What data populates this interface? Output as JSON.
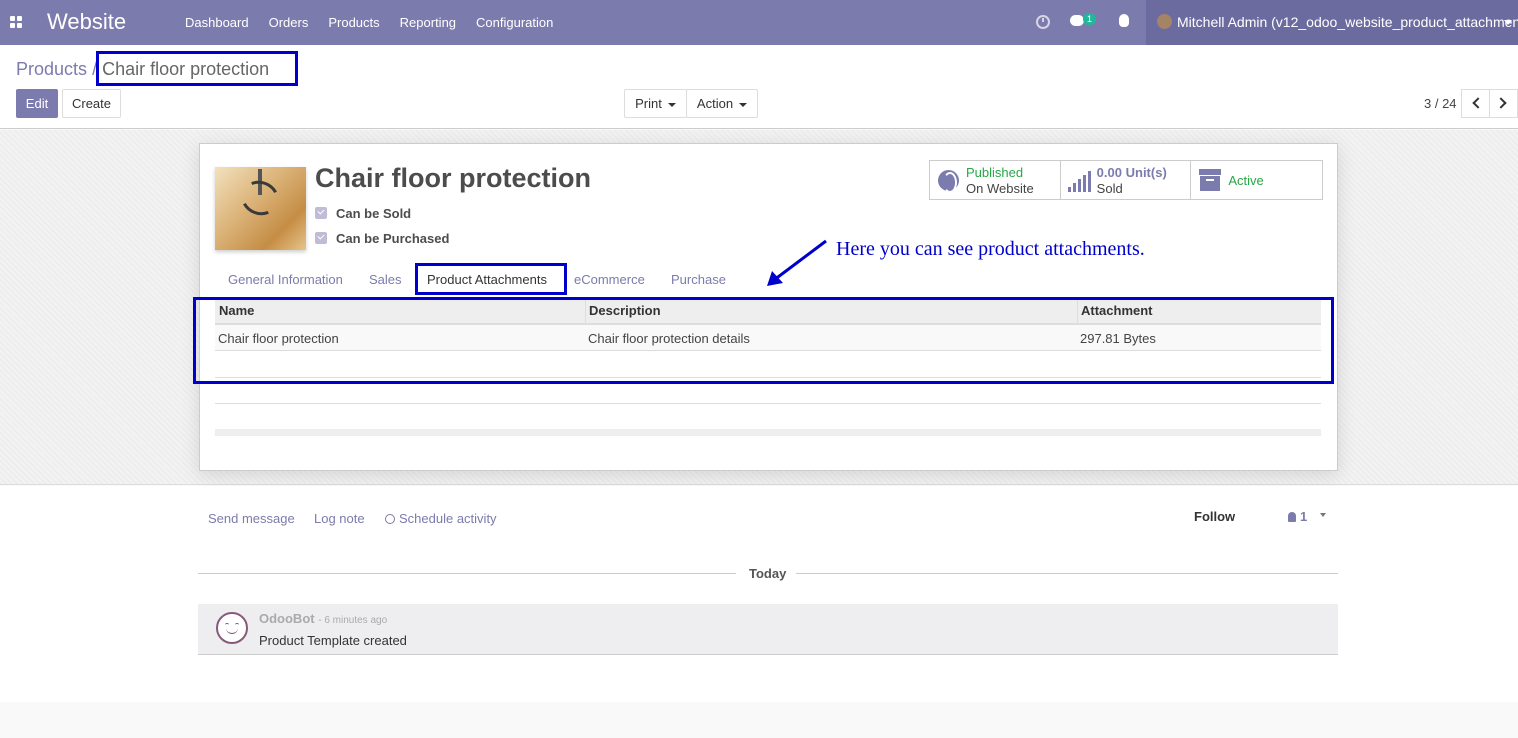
{
  "navbar": {
    "brand": "Website",
    "menu": [
      "Dashboard",
      "Orders",
      "Products",
      "Reporting",
      "Configuration"
    ],
    "chat_badge": "1",
    "user_name": "Mitchell Admin (v12_odoo_website_product_attachment)",
    "bg_color": "#7c7bad"
  },
  "breadcrumb": {
    "parent": "Products",
    "separator": "/",
    "current": "Chair floor protection"
  },
  "buttons": {
    "edit": "Edit",
    "create": "Create",
    "print": "Print",
    "action": "Action"
  },
  "pager": {
    "value": "3 / 24"
  },
  "product": {
    "title": "Chair floor protection",
    "can_be_sold": "Can be Sold",
    "can_be_purchased": "Can be Purchased"
  },
  "smart_buttons": {
    "published_line1": "Published",
    "published_line2": "On Website",
    "sold_value": "0.00",
    "sold_unit": "Unit(s)",
    "sold_label": "Sold",
    "active": "Active"
  },
  "annotation": "Here you can see product attachments.",
  "tabs": [
    "General Information",
    "Sales",
    "Product Attachments",
    "eCommerce",
    "Purchase"
  ],
  "active_tab": "Product Attachments",
  "attachments": {
    "columns": [
      "Name",
      "Description",
      "Attachment"
    ],
    "rows": [
      [
        "Chair floor protection",
        "Chair floor protection details",
        "297.81 Bytes"
      ]
    ]
  },
  "chatter": {
    "send_message": "Send message",
    "log_note": "Log note",
    "schedule_activity": "Schedule activity",
    "follow": "Follow",
    "followers_count": "1",
    "today": "Today",
    "message": {
      "author": "OdooBot",
      "time": "- 6 minutes ago",
      "body": "Product Template created"
    }
  },
  "highlight_color": "#0000cc"
}
